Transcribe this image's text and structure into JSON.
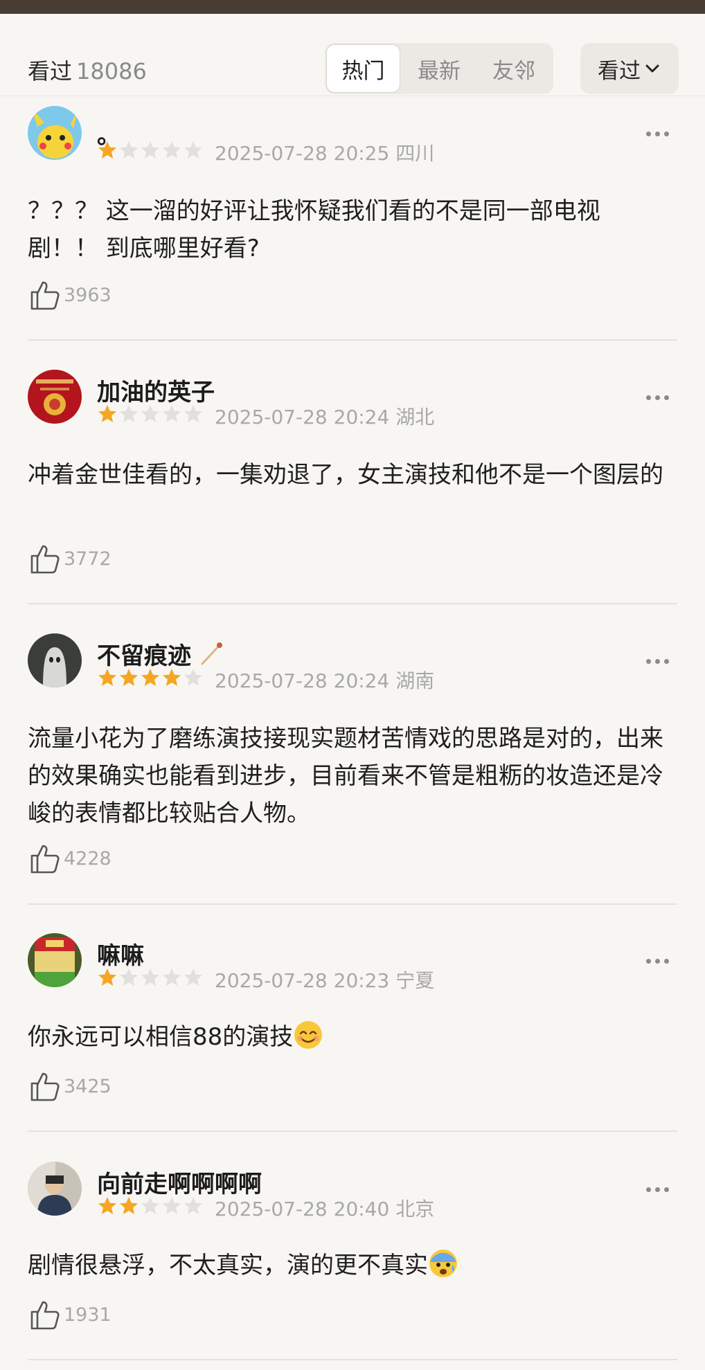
{
  "header": {
    "seen_label": "看过",
    "seen_count": "18086",
    "tabs": [
      {
        "label": "热门"
      },
      {
        "label": "最新"
      },
      {
        "label": "友邻"
      }
    ],
    "sort_label": "看过"
  },
  "colors": {
    "star_filled": "#f5a623",
    "star_empty": "#e2e0dd",
    "top_bar": "#4a3d33"
  },
  "comments": [
    {
      "username": "。",
      "rating": 1,
      "date": "2025-07-28 20:25",
      "location": "四川",
      "text": "？？？ 这一溜的好评让我怀疑我们看的不是同一部电视剧！！ 到底哪里好看?",
      "likes": "3963",
      "avatar_icon": "pikachu-avatar-icon"
    },
    {
      "username": "加油的英子",
      "rating": 1,
      "date": "2025-07-28 20:24",
      "location": "湖北",
      "text": "冲着金世佳看的，一集劝退了，女主演技和他不是一个图层的",
      "likes": "3772",
      "avatar_icon": "red-new-year-avatar-icon"
    },
    {
      "username": "不留痕迹",
      "rating": 4,
      "date": "2025-07-28 20:24",
      "location": "湖南",
      "text": "流量小花为了磨练演技接现实题材苦情戏的思路是对的，出来的效果确实也能看到进步，目前看来不管是粗粝的妆造还是冷峻的表情都比较贴合人物。",
      "likes": "4228",
      "avatar_icon": "ghost-avatar-icon",
      "badge_icon": "match-stick-icon"
    },
    {
      "username": "嘛嘛",
      "rating": 1,
      "date": "2025-07-28 20:23",
      "location": "宁夏",
      "text": "你永远可以相信88的演技",
      "text_emoji": "smiling-face-emoji",
      "likes": "3425",
      "avatar_icon": "soy-sauce-bottle-avatar-icon"
    },
    {
      "username": "向前走啊啊啊啊",
      "rating": 2,
      "date": "2025-07-28 20:40",
      "location": "北京",
      "text": "剧情很悬浮，不太真实，演的更不真实",
      "text_emoji": "anxious-face-emoji",
      "likes": "1931",
      "avatar_icon": "person-photo-avatar-icon"
    }
  ]
}
